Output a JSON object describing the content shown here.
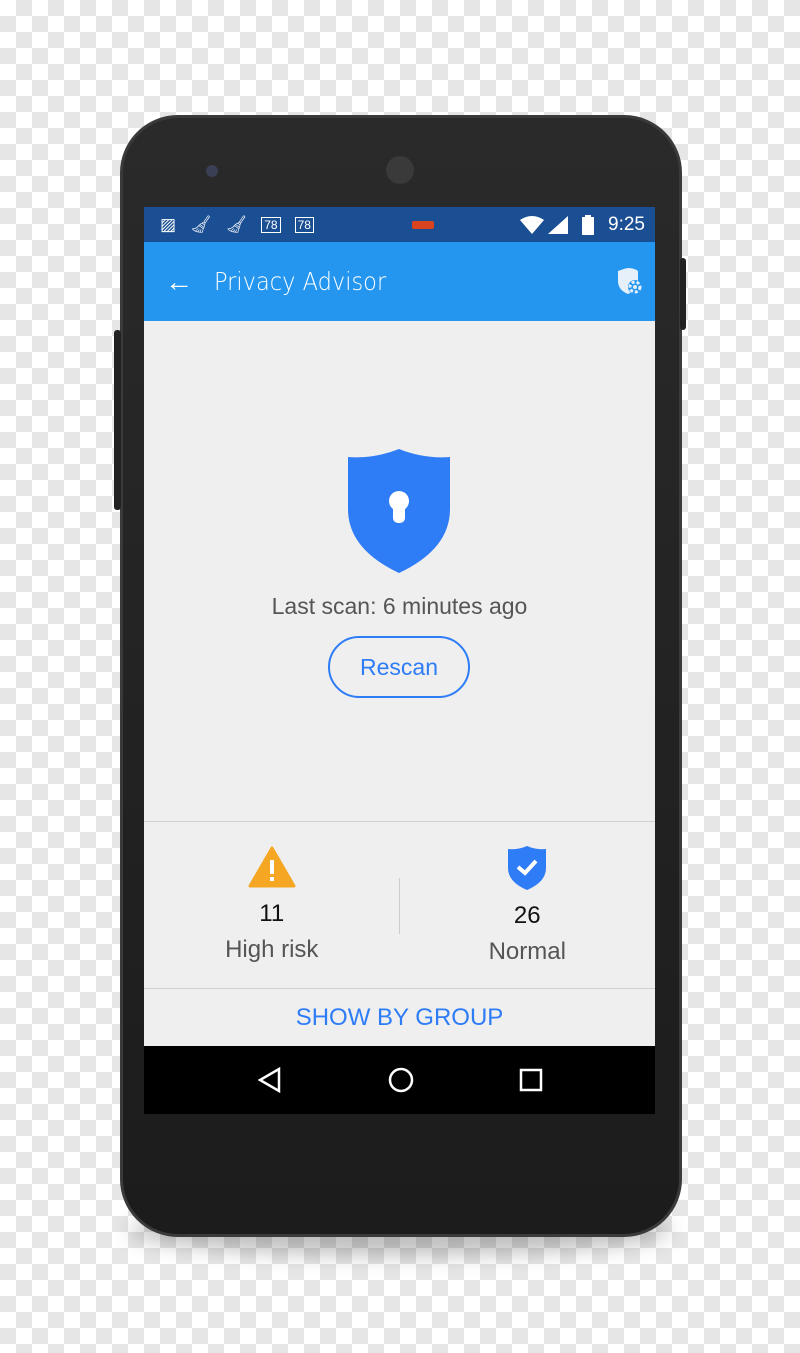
{
  "colors": {
    "appbar": "#2596f0",
    "statusbar": "#1b4f93",
    "accent": "#2e7cf6",
    "warning": "#f5a623"
  },
  "statusbar": {
    "badge1": "78",
    "badge2": "78",
    "time": "9:25",
    "icons": [
      "image-icon",
      "broom-icon",
      "broom-icon",
      "battery-icon",
      "wifi-icon",
      "signal-icon"
    ]
  },
  "appbar": {
    "title": "Privacy Advisor",
    "back_icon": "arrow-left-icon",
    "settings_icon": "shield-gear-icon"
  },
  "main": {
    "last_scan": "Last scan: 6 minutes ago",
    "rescan_label": "Rescan"
  },
  "stats": [
    {
      "count": "11",
      "label": "High risk",
      "icon": "warning-icon"
    },
    {
      "count": "26",
      "label": "Normal",
      "icon": "shield-check-icon"
    }
  ],
  "show_by_group": "SHOW BY GROUP",
  "navbar": [
    "back-icon",
    "home-icon",
    "recents-icon"
  ]
}
